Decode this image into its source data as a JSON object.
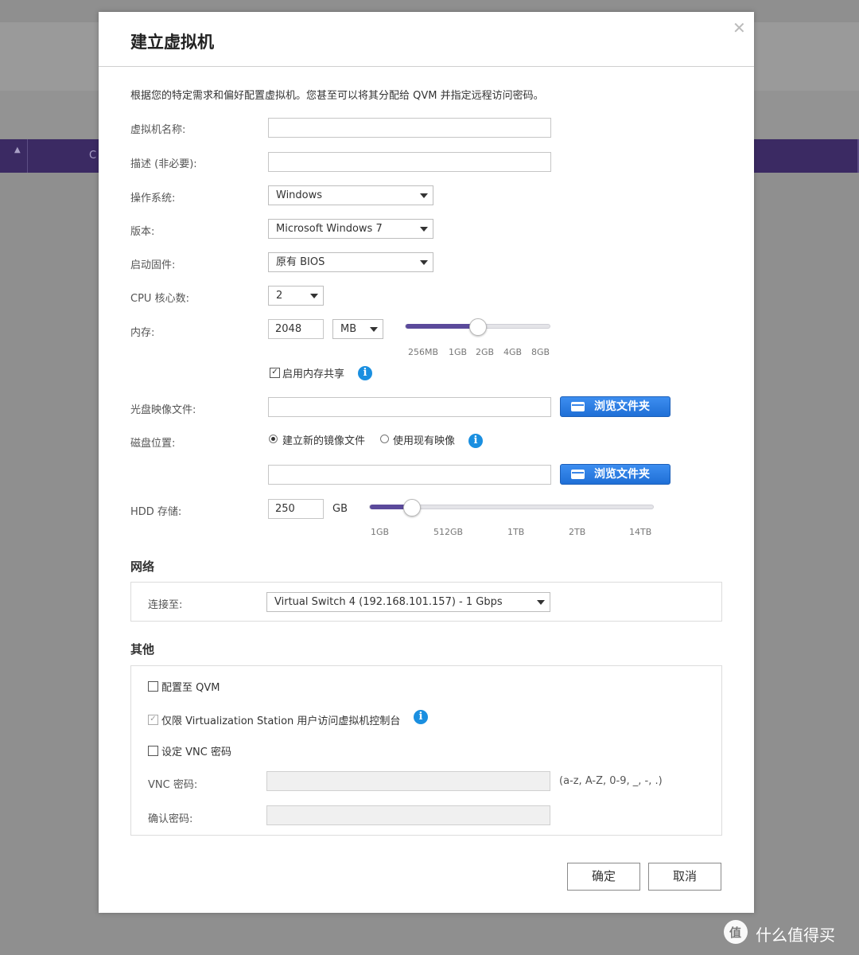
{
  "background": {
    "column_letter": "C"
  },
  "dialog": {
    "title": "建立虚拟机",
    "description": "根据您的特定需求和偏好配置虚拟机。您甚至可以将其分配给 QVM 并指定远程访问密码。",
    "fields": {
      "vm_name": {
        "label": "虚拟机名称:",
        "value": ""
      },
      "desc": {
        "label": "描述 (非必要):",
        "value": ""
      },
      "os": {
        "label": "操作系统:",
        "value": "Windows"
      },
      "version": {
        "label": "版本:",
        "value": "Microsoft Windows 7"
      },
      "firmware": {
        "label": "启动固件:",
        "value": "原有 BIOS"
      },
      "cpu": {
        "label": "CPU 核心数:",
        "value": "2"
      },
      "memory": {
        "label": "内存:",
        "value": "2048",
        "unit": "MB",
        "slider_ticks": [
          "256MB",
          "1GB",
          "2GB",
          "4GB",
          "8GB"
        ],
        "slider_level": 0.49,
        "share_label": "启用内存共享",
        "share_checked": true
      },
      "iso": {
        "label": "光盘映像文件:",
        "value": "",
        "browse_label": "浏览文件夹"
      },
      "disk_location": {
        "label": "磁盘位置:",
        "option_new": "建立新的镜像文件",
        "option_existing": "使用现有映像",
        "selected": "new",
        "path_value": "",
        "browse_label": "浏览文件夹"
      },
      "hdd": {
        "label": "HDD 存储:",
        "value": "250",
        "unit": "GB",
        "slider_ticks": [
          "1GB",
          "512GB",
          "1TB",
          "2TB",
          "14TB"
        ],
        "slider_level": 0.145
      }
    },
    "network": {
      "title": "网络",
      "connect_label": "连接至:",
      "connect_value": "Virtual Switch 4 (192.168.101.157) - 1 Gbps"
    },
    "other": {
      "title": "其他",
      "assign_qvm": "配置至 QVM",
      "vs_only": "仅限 Virtualization Station 用户访问虚拟机控制台",
      "set_vnc": "设定 VNC 密码",
      "vnc_label": "VNC 密码:",
      "vnc_hint": "(a-z, A-Z, 0-9, _, -, .)",
      "confirm_label": "确认密码:"
    },
    "buttons": {
      "ok": "确定",
      "cancel": "取消"
    }
  },
  "watermark": {
    "text": "什么值得买"
  },
  "colors": {
    "accent": "#5b4a9b",
    "button_blue": "#2a7be3",
    "info_blue": "#1a8fe0"
  }
}
